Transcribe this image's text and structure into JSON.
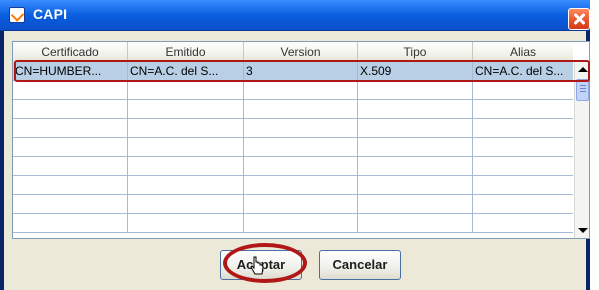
{
  "window": {
    "title": "CAPI"
  },
  "table": {
    "columns": [
      "Certificado",
      "Emitido",
      "Version",
      "Tipo",
      "Alias"
    ],
    "rows": [
      [
        "CN=HUMBER...",
        "CN=A.C. del S...",
        "3",
        "X.509",
        "CN=A.C. del S..."
      ]
    ],
    "empty_row_count": 8
  },
  "buttons": {
    "accept_label": "Aceptar",
    "cancel_label": "Cancelar"
  },
  "icons": {
    "title_icon": "java-icon",
    "close_icon": "close-icon",
    "cursor": "hand-pointer-icon"
  },
  "colors": {
    "titlebar": "#0a5fe0",
    "selection": "#b8cfe5",
    "annotation": "#b01818"
  }
}
